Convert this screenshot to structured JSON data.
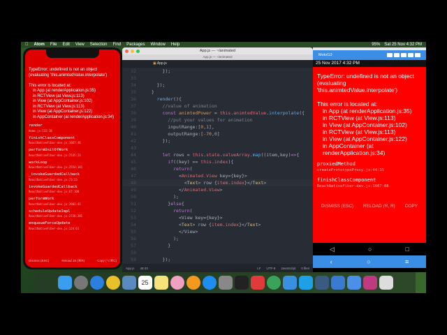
{
  "menubar": {
    "items": [
      "Atom",
      "File",
      "Edit",
      "View",
      "Selection",
      "Find",
      "Packages",
      "Window",
      "Help"
    ],
    "battery": "95%",
    "clock": "Sat 25 Nov  4:32 PM"
  },
  "left_error": {
    "title": "TypeError: undefined is not an object (evaluating 'this.animtedValue.interpolate')",
    "located": "This error is located at:",
    "stack": [
      "in App (at renderApplication.js:35)",
      "in RCTView (at View.js:113)",
      "in View (at AppContainer.js:102)",
      "in RCTView (at View.js:113)",
      "in View (at AppContainer.js:122)",
      "in AppContainer (at renderApplication.js:34)"
    ],
    "frames": [
      {
        "fn": "render",
        "loc": "Home.js:132:18"
      },
      {
        "fn": "finishClassComponent",
        "loc": "ReactNativeFiber-dev.js:1667:46"
      },
      {
        "fn": "performUnitOfWork",
        "loc": "ReactNativeFiber-dev.js:2535:23"
      },
      {
        "fn": "workLoop",
        "loc": "ReactNativeFiber-dev.js:2554:141"
      },
      {
        "fn": "_invokeGuardedCallback",
        "loc": "ReactNativeFiber-dev.js:73:23"
      },
      {
        "fn": "invokeGuardedCallback",
        "loc": "ReactNativeFiber-dev.js:67:108"
      },
      {
        "fn": "performWork",
        "loc": "ReactNativeFiber-dev.js:2603:41"
      },
      {
        "fn": "scheduleUpdateImpl",
        "loc": "ReactNativeFiber-dev.js:2728:201"
      },
      {
        "fn": "enqueueForceUpdate",
        "loc": "ReactNativeFiber-dev.js:124:61"
      }
    ],
    "buttons": [
      "Dismiss (ESC)",
      "Reload JS (⌘R)",
      "Copy (⌥⌘C)"
    ]
  },
  "atom": {
    "title": "App.js — ~/animated",
    "subtitle": "App.js — ~/animated",
    "tab": "App.js",
    "status": {
      "file": "App.js",
      "cursor": "48:43",
      "eol": "LF",
      "encoding": "UTF-8",
      "grammar": "JavaScript",
      "files": "0 files"
    },
    "lines": [
      {
        "n": "32",
        "tk": [
          [
            "      });",
            "p"
          ]
        ]
      },
      {
        "n": "33",
        "tk": []
      },
      {
        "n": "34",
        "tk": [
          [
            "    });",
            "p"
          ]
        ]
      },
      {
        "n": "35",
        "tk": [
          [
            "  }",
            "p"
          ]
        ]
      },
      {
        "n": "36",
        "tk": [
          [
            "    ",
            "p"
          ],
          [
            "render",
            "f"
          ],
          [
            "(){",
            "p"
          ]
        ]
      },
      {
        "n": "37",
        "tk": [
          [
            "      //value of animation",
            "c"
          ]
        ]
      },
      {
        "n": "38",
        "tk": [
          [
            "      ",
            "p"
          ],
          [
            "const ",
            "k"
          ],
          [
            "animtedPower",
            "nm"
          ],
          [
            " = ",
            "p"
          ],
          [
            "this",
            "v"
          ],
          [
            ".",
            "p"
          ],
          [
            "animtedValue",
            "v"
          ],
          [
            ".",
            "p"
          ],
          [
            "interpolate",
            "f"
          ],
          [
            "({",
            "p"
          ]
        ]
      },
      {
        "n": "39",
        "tk": [
          [
            "        //put your values for animation",
            "c"
          ]
        ]
      },
      {
        "n": "40",
        "tk": [
          [
            "        inputRange:[",
            "p"
          ],
          [
            "0",
            "nm"
          ],
          [
            ",",
            "p"
          ],
          [
            "1",
            "nm"
          ],
          [
            "],",
            "p"
          ]
        ]
      },
      {
        "n": "41",
        "tk": [
          [
            "        outputRange:[",
            "p"
          ],
          [
            "-70",
            "nm"
          ],
          [
            ",",
            "p"
          ],
          [
            "0",
            "nm"
          ],
          [
            "]",
            "p"
          ]
        ]
      },
      {
        "n": "42",
        "tk": [
          [
            "      });",
            "p"
          ]
        ]
      },
      {
        "n": "43",
        "tk": []
      },
      {
        "n": "44",
        "tk": [
          [
            "      ",
            "p"
          ],
          [
            "let ",
            "k"
          ],
          [
            "rows = ",
            "p"
          ],
          [
            "this",
            "v"
          ],
          [
            ".",
            "p"
          ],
          [
            "state",
            "v"
          ],
          [
            ".",
            "p"
          ],
          [
            "valueArray",
            "v"
          ],
          [
            ".",
            "p"
          ],
          [
            "map",
            "f"
          ],
          [
            "((item,key)",
            "p"
          ],
          [
            "=>",
            "k"
          ],
          [
            "{",
            "p"
          ]
        ]
      },
      {
        "n": "45",
        "tk": [
          [
            "        ",
            "p"
          ],
          [
            "if",
            "k"
          ],
          [
            "((key) == ",
            "p"
          ],
          [
            "this",
            "v"
          ],
          [
            ".",
            "p"
          ],
          [
            "index",
            "v"
          ],
          [
            "){",
            "p"
          ]
        ]
      },
      {
        "n": "46",
        "tk": [
          [
            "          ",
            "p"
          ],
          [
            "return",
            "k"
          ],
          [
            "(",
            "p"
          ]
        ]
      },
      {
        "n": "47",
        "tk": [
          [
            "            <",
            "p"
          ],
          [
            "Animated.View",
            "v"
          ],
          [
            " key={key}>",
            "p"
          ]
        ]
      },
      {
        "n": "48",
        "tk": [
          [
            "              <",
            "p"
          ],
          [
            "Text",
            "t"
          ],
          [
            "> row {",
            "p"
          ],
          [
            "item.index",
            "v"
          ],
          [
            "}</",
            "p"
          ],
          [
            "Text",
            "t"
          ],
          [
            ">",
            "p"
          ]
        ]
      },
      {
        "n": "49",
        "tk": [
          [
            "            </",
            "p"
          ],
          [
            "Animated.View",
            "v"
          ],
          [
            ">",
            "p"
          ]
        ]
      },
      {
        "n": "50",
        "tk": [
          [
            "          );",
            "p"
          ]
        ]
      },
      {
        "n": "51",
        "tk": [
          [
            "        }",
            "p"
          ],
          [
            "else",
            "k"
          ],
          [
            "{",
            "p"
          ]
        ]
      },
      {
        "n": "52",
        "tk": [
          [
            "          ",
            "p"
          ],
          [
            "return",
            "k"
          ],
          [
            "(",
            "p"
          ]
        ]
      },
      {
        "n": "53",
        "tk": [
          [
            "            <View key={key}>",
            "p"
          ]
        ]
      },
      {
        "n": "54",
        "tk": [
          [
            "            <",
            "p"
          ],
          [
            "Text",
            "t"
          ],
          [
            "> row {",
            "p"
          ],
          [
            "item.index",
            "v"
          ],
          [
            "}</",
            "p"
          ],
          [
            "Text",
            "t"
          ],
          [
            ">",
            "p"
          ]
        ]
      },
      {
        "n": "55",
        "tk": [
          [
            "            </View>",
            "p"
          ]
        ]
      },
      {
        "n": "56",
        "tk": [
          [
            "          );",
            "p"
          ]
        ]
      },
      {
        "n": "57",
        "tk": [
          [
            "        }",
            "p"
          ]
        ]
      },
      {
        "n": "58",
        "tk": []
      },
      {
        "n": "59",
        "tk": [
          [
            "      });",
            "p"
          ]
        ]
      }
    ],
    "cursor_line": "48"
  },
  "geny": {
    "device": "MotoG3",
    "android_status": "25 Nov 2017 4:32 PM",
    "error_title": "TypeError: undefined is not an object (evaluating 'this.animtedValue.interpolate')",
    "located": "This error is located at:",
    "stack": [
      "in App (at renderApplication.js:35)",
      "in RCTView (at View.js:113)",
      "in View (at AppContainer.js:102)",
      "in RCTView (at View.js:113)",
      "in View (at AppContainer.js:122)",
      "in AppContainer (at renderApplication.js:34)"
    ],
    "frames": [
      {
        "fn": "proxiedMethod",
        "loc": "createPrototypeProxy.js:44:35"
      },
      {
        "fn": "finishClassComponent",
        "loc": "ReactNativeFiber-dev.js:1667:86"
      }
    ],
    "buttons": [
      "DISMISS (ESC)",
      "RELOAD (R, R)",
      "COPY"
    ]
  },
  "dock": {
    "apps": [
      {
        "name": "finder",
        "c": "#3a9ef0"
      },
      {
        "name": "launchpad",
        "c": "#777"
      },
      {
        "name": "safari",
        "c": "#2a7fe0"
      },
      {
        "name": "chrome",
        "c": "#e8c02a"
      },
      {
        "name": "preview",
        "c": "#5a8ac0"
      },
      {
        "name": "calendar",
        "c": "#fff"
      },
      {
        "name": "notes",
        "c": "#f7e27a"
      },
      {
        "name": "photos",
        "c": "#f0a0c0"
      },
      {
        "name": "ibooks",
        "c": "#f39a1e"
      },
      {
        "name": "app-store",
        "c": "#1e8df0"
      },
      {
        "name": "system-preferences",
        "c": "#888"
      },
      {
        "name": "terminal",
        "c": "#222"
      },
      {
        "name": "video-app",
        "c": "#e03a3a"
      },
      {
        "name": "atom",
        "c": "#3aa35a"
      },
      {
        "name": "xcode",
        "c": "#3a90e0"
      },
      {
        "name": "skype",
        "c": "#1ea0e8"
      },
      {
        "name": "genymotion",
        "c": "#3a5a80"
      },
      {
        "name": "file-app",
        "c": "#3a7ad0"
      },
      {
        "name": "simulator",
        "c": "#4a90e8"
      },
      {
        "name": "photo-booth",
        "c": "#c03a80"
      },
      {
        "name": "trash",
        "c": "#ddd"
      }
    ],
    "calendar_day": "25"
  }
}
